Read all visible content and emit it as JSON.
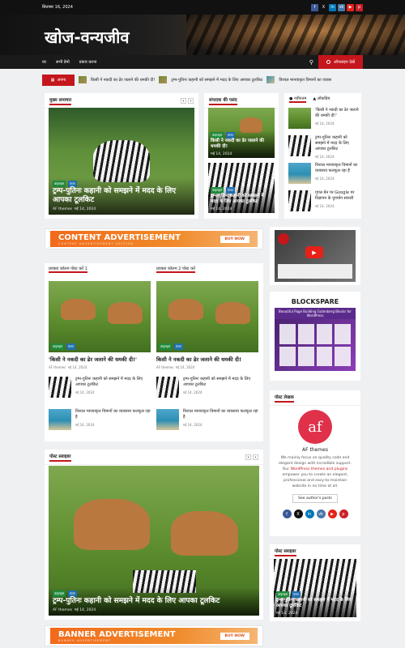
{
  "topbar": {
    "date": "सितम्बर 16, 2024"
  },
  "social": [
    {
      "icon": "facebook-icon",
      "glyph": "f",
      "color": "#3b5998"
    },
    {
      "icon": "x-icon",
      "glyph": "X",
      "color": "#111111"
    },
    {
      "icon": "linkedin-icon",
      "glyph": "in",
      "color": "#0077b5"
    },
    {
      "icon": "vk-icon",
      "glyph": "vk",
      "color": "#4a76a8"
    },
    {
      "icon": "youtube-icon",
      "glyph": "▶",
      "color": "#e62117"
    },
    {
      "icon": "pinterest-icon",
      "glyph": "p",
      "color": "#cb2027"
    }
  ],
  "site": {
    "title": "खोज-वन्यजीव"
  },
  "nav": {
    "items": [
      "घर",
      "सभी डेमो",
      "प्रकार करना"
    ],
    "search_icon": "search-icon",
    "live_label": "ऑनलाइन देखें"
  },
  "ticker": {
    "badge": "अपना",
    "items": [
      "किसी ने नकदी का ढेर जलाने की धमकी दी!",
      "ट्रम्प-पुतिनः कहानी को समझने में मदद के लिए आपका टूलकिट",
      "विशाल मानवाकृत विमानों का व्यवस"
    ]
  },
  "main_news": {
    "title": "मुख्य समाचार",
    "tags": [
      "वाइल्ड्स",
      "यात्रा"
    ],
    "headline": "ट्रम्प-पुतिनः कहानी को समझने में मदद के लिए आपका टूलकिट",
    "author": "AF themes",
    "date": "मई 14, 2024"
  },
  "editor_pick": {
    "title": "संपादक की पसंद",
    "items": [
      {
        "tags": [
          "वाइल्ड्स",
          "यात्रा"
        ],
        "headline": "किसी ने नकदी का ढेर जलाने की धमकी दी!",
        "date": "मई 14, 2024"
      },
      {
        "tags": [
          "वाइल्ड्स",
          "यात्रा"
        ],
        "headline": "ट्रम्प-पुतिनः कहानी को समझने में मदद के लिए आपका टूलकिट",
        "date": "मई 14, 2024"
      }
    ]
  },
  "latest": {
    "tabs": [
      "नवीनतम",
      "लोकप्रिय"
    ],
    "items": [
      {
        "headline": "'किसी ने नकदी का ढेर जलाने की धमकी दी!'",
        "date": "मई 14, 2024"
      },
      {
        "headline": "ट्रम्प-पुतिनः कहानी को समझने में मदद के लिए आपका टूलकिट",
        "date": "मई 14, 2024"
      },
      {
        "headline": "विशाल मानवाकृत विमानों का व्यवसाय फलफूल रहा है",
        "date": "मई 14, 2024"
      },
      {
        "headline": "गूगल बेन पर Google पर विज्ञापन के पुनर्मान सफारी",
        "date": "मई 14, 2024"
      }
    ]
  },
  "content_ad": {
    "title": "CONTENT ADVERTISEMENT",
    "sub": "CONTENT ADVERTISEMENT SECTION",
    "button": "BUY NOW"
  },
  "banner_ad": {
    "title": "BANNER ADVERTISEMENT",
    "sub": "BANNER ADVERTISEMENT",
    "button": "BUY NOW"
  },
  "post_cols": {
    "col1": {
      "title": "प्रवक्ता कॉलम पोस्ट करें 1",
      "headline": "'किसी ने नकदी का ढेर जलाने की धमकी दी!'",
      "author": "AF themes",
      "date": "मई 14, 2024",
      "items": [
        {
          "headline": "ट्रम्प-पुतिनः कहानी को समझने में मदद के लिए आपका टूलकिट",
          "date": "मई 14, 2024"
        },
        {
          "headline": "विशाल मानवाकृत विमानों का व्यवसाय फलफूल रहा है",
          "date": "मई 14, 2024"
        }
      ]
    },
    "col2": {
      "title": "प्रवक्ता कॉलम 2 पोस्ट करें",
      "headline": "किसी ने नकदी का ढेर जलाने की धमकी दी!",
      "author": "AF themes",
      "date": "मई 14, 2024",
      "items": [
        {
          "headline": "ट्रम्प-पुतिनः कहानी को समझने में मदद के लिए आपका टूलकिट",
          "date": "मई 14, 2024"
        },
        {
          "headline": "विशाल मानवाकृत विमानों का व्यवसाय फलफूल रहा है",
          "date": "मई 14, 2024"
        }
      ]
    },
    "tags": [
      "वाइल्ड्स",
      "यात्रा"
    ]
  },
  "post_slider": {
    "title": "पोस्ट स्लाइडर",
    "tags": [
      "वाइल्ड्स",
      "यात्रा"
    ],
    "headline": "ट्रम्प-पुतिनः कहानी को समझने में मदद के लिए आपका टूलकिट",
    "author": "AF themes",
    "date": "मई 14, 2024"
  },
  "sidebar": {
    "blockspare": {
      "title": "BLOCKSPARE",
      "sub": "Beautiful Page Building Gutenberg Blocks for WordPress"
    },
    "author": {
      "title": "पोस्ट लेखक",
      "name": "AF themes",
      "bio_1": "We mainly focus on quality code and elegant design with incredible support. Our ",
      "bio_link": "WordPress themes and plugins",
      "bio_2": " empower you to create an elegant, professional and easy-to-maintain website in no time at all.",
      "button": "See author's posts"
    },
    "slider": {
      "title": "पोस्ट स्लाइडर",
      "tags": [
        "वाइल्ड्स",
        "यात्रा"
      ],
      "headline": "ट्रम्प-पुतिनः कहानी को समझने में मदद के लिए आपका टूलकिट",
      "date": "मई 14, 2024"
    }
  }
}
